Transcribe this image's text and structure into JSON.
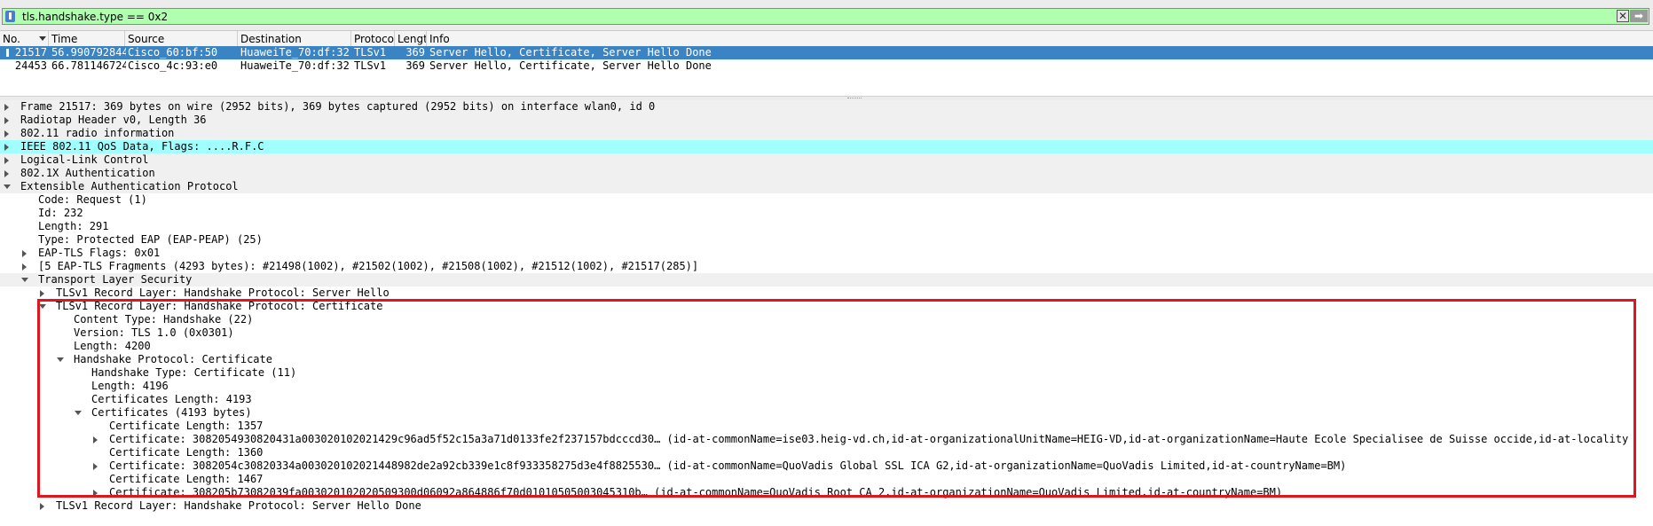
{
  "filter": {
    "value": "tls.handshake.type == 0x2",
    "color": "#afffaf"
  },
  "packet_list": {
    "columns": [
      "No.",
      "Time",
      "Source",
      "Destination",
      "Protocol",
      "Length",
      "Info"
    ],
    "rows": [
      {
        "no": "21517",
        "time": "56.990792844",
        "source": "Cisco_60:bf:50",
        "destination": "HuaweiTe_70:df:32",
        "protocol": "TLSv1",
        "length": "369",
        "info": "Server Hello, Certificate, Server Hello Done",
        "selected": true
      },
      {
        "no": "24453",
        "time": "66.781146724",
        "source": "Cisco_4c:93:e0",
        "destination": "HuaweiTe_70:df:32",
        "protocol": "TLSv1",
        "length": "369",
        "info": "Server Hello, Certificate, Server Hello Done",
        "selected": false
      }
    ]
  },
  "details": [
    {
      "text": "Frame 21517: 369 bytes on wire (2952 bits), 369 bytes captured (2952 bits) on interface wlan0, id 0",
      "level": 0,
      "expander": "collapsed",
      "style": "shaded"
    },
    {
      "text": "Radiotap Header v0, Length 36",
      "level": 0,
      "expander": "collapsed",
      "style": "shaded"
    },
    {
      "text": "802.11 radio information",
      "level": 0,
      "expander": "collapsed",
      "style": "shaded"
    },
    {
      "text": "IEEE 802.11 QoS Data, Flags: ....R.F.C",
      "level": 0,
      "expander": "collapsed",
      "style": "hl"
    },
    {
      "text": "Logical-Link Control",
      "level": 0,
      "expander": "collapsed",
      "style": "shaded"
    },
    {
      "text": "802.1X Authentication",
      "level": 0,
      "expander": "collapsed",
      "style": "shaded"
    },
    {
      "text": "Extensible Authentication Protocol",
      "level": 0,
      "expander": "expanded",
      "style": "shaded"
    },
    {
      "text": "Code: Request (1)",
      "level": 1,
      "expander": "none",
      "style": ""
    },
    {
      "text": "Id: 232",
      "level": 1,
      "expander": "none",
      "style": ""
    },
    {
      "text": "Length: 291",
      "level": 1,
      "expander": "none",
      "style": ""
    },
    {
      "text": "Type: Protected EAP (EAP-PEAP) (25)",
      "level": 1,
      "expander": "none",
      "style": ""
    },
    {
      "text": "EAP-TLS Flags: 0x01",
      "level": 1,
      "expander": "collapsed",
      "style": ""
    },
    {
      "text": "[5 EAP-TLS Fragments (4293 bytes): #21498(1002), #21502(1002), #21508(1002), #21512(1002), #21517(285)]",
      "level": 1,
      "expander": "collapsed",
      "style": ""
    },
    {
      "text": "Transport Layer Security",
      "level": 1,
      "expander": "expanded",
      "style": "shaded"
    },
    {
      "text": "TLSv1 Record Layer: Handshake Protocol: Server Hello",
      "level": 2,
      "expander": "collapsed",
      "style": ""
    },
    {
      "text": "TLSv1 Record Layer: Handshake Protocol: Certificate",
      "level": 2,
      "expander": "expanded",
      "style": ""
    },
    {
      "text": "Content Type: Handshake (22)",
      "level": 3,
      "expander": "none",
      "style": ""
    },
    {
      "text": "Version: TLS 1.0 (0x0301)",
      "level": 3,
      "expander": "none",
      "style": ""
    },
    {
      "text": "Length: 4200",
      "level": 3,
      "expander": "none",
      "style": ""
    },
    {
      "text": "Handshake Protocol: Certificate",
      "level": 3,
      "expander": "expanded",
      "style": ""
    },
    {
      "text": "Handshake Type: Certificate (11)",
      "level": 4,
      "expander": "none",
      "style": ""
    },
    {
      "text": "Length: 4196",
      "level": 4,
      "expander": "none",
      "style": ""
    },
    {
      "text": "Certificates Length: 4193",
      "level": 4,
      "expander": "none",
      "style": ""
    },
    {
      "text": "Certificates (4193 bytes)",
      "level": 4,
      "expander": "expanded",
      "style": ""
    },
    {
      "text": "Certificate Length: 1357",
      "level": 5,
      "expander": "none",
      "style": ""
    },
    {
      "text": "Certificate: 3082054930820431a003020102021429c96ad5f52c15a3a71d0133fe2f237157bdcccd30… (id-at-commonName=ise03.heig-vd.ch,id-at-organizationalUnitName=HEIG-VD,id-at-organizationName=Haute Ecole Specialisee de Suisse occide,id-at-locality",
      "level": 5,
      "expander": "collapsed",
      "style": ""
    },
    {
      "text": "Certificate Length: 1360",
      "level": 5,
      "expander": "none",
      "style": ""
    },
    {
      "text": "Certificate: 3082054c30820334a003020102021448982de2a92cb339e1c8f933358275d3e4f8825530… (id-at-commonName=QuoVadis Global SSL ICA G2,id-at-organizationName=QuoVadis Limited,id-at-countryName=BM)",
      "level": 5,
      "expander": "collapsed",
      "style": ""
    },
    {
      "text": "Certificate Length: 1467",
      "level": 5,
      "expander": "none",
      "style": ""
    },
    {
      "text": "Certificate: 308205b73082039fa003020102020509300d06092a864886f70d01010505003045310b… (id-at-commonName=QuoVadis Root CA 2,id-at-organizationName=QuoVadis Limited,id-at-countryName=BM)",
      "level": 5,
      "expander": "collapsed",
      "style": ""
    },
    {
      "text": "TLSv1 Record Layer: Handshake Protocol: Server Hello Done",
      "level": 2,
      "expander": "collapsed",
      "style": ""
    }
  ],
  "colors": {
    "selected_row": "#3b84c4",
    "highlight_row": "#a0ffff",
    "annotation_box": "#e0161c"
  }
}
